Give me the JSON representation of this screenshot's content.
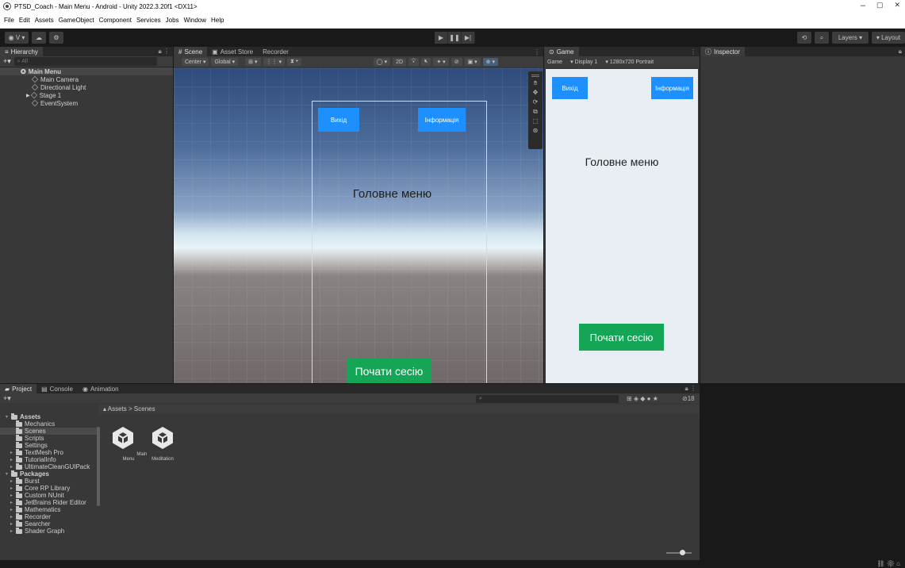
{
  "window": {
    "title": "PTSD_Coach - Main Menu - Android - Unity 2022.3.20f1 <DX11>",
    "controls": [
      "–",
      "▢",
      "✕"
    ]
  },
  "menu": [
    "File",
    "Edit",
    "Assets",
    "GameObject",
    "Component",
    "Services",
    "Jobs",
    "Window",
    "Help"
  ],
  "toolbar": {
    "account": "◉ V ▾",
    "right": {
      "layers": "Layers",
      "layout": "Layout"
    }
  },
  "hierarchy": {
    "tab": "Hierarchy",
    "search_placeholder": "All",
    "scene": "Main Menu",
    "items": [
      "Main Camera",
      "Directional Light",
      "Stage 1",
      "EventSystem"
    ]
  },
  "scene": {
    "tabs": [
      "Scene",
      "Asset Store",
      "Recorder"
    ],
    "toolbar": {
      "pivot": "Center ▾",
      "space": "Global ▾",
      "mode2d": "2D"
    },
    "ui": {
      "exit": "Вихід",
      "info": "Інформація",
      "heading": "Головне меню",
      "start": "Почати сесію"
    }
  },
  "game": {
    "tab": "Game",
    "toolbar": {
      "mode": "Game",
      "display": "Display 1",
      "resolution": "1280x720 Portrait"
    },
    "ui": {
      "exit": "Вихід",
      "info": "Інформація",
      "heading": "Головне меню",
      "start": "Почати сесію"
    }
  },
  "inspector": {
    "tab": "Inspector"
  },
  "project": {
    "tabs": [
      "Project",
      "Console",
      "Animation"
    ],
    "breadcrumb": "Assets  >  Scenes",
    "hidden_count": "18",
    "tree": [
      {
        "label": "Assets",
        "level": 0,
        "bold": true
      },
      {
        "label": "Mechanics",
        "level": 1
      },
      {
        "label": "Scenes",
        "level": 1,
        "selected": true
      },
      {
        "label": "Scripts",
        "level": 1
      },
      {
        "label": "Settings",
        "level": 1
      },
      {
        "label": "TextMesh Pro",
        "level": 1
      },
      {
        "label": "TutorialInfo",
        "level": 1
      },
      {
        "label": "UltimateCleanGUIPack",
        "level": 1
      },
      {
        "label": "Packages",
        "level": 0,
        "bold": true
      },
      {
        "label": "Burst",
        "level": 1
      },
      {
        "label": "Core RP Library",
        "level": 1
      },
      {
        "label": "Custom NUnit",
        "level": 1
      },
      {
        "label": "JetBrains Rider Editor",
        "level": 1
      },
      {
        "label": "Mathematics",
        "level": 1
      },
      {
        "label": "Recorder",
        "level": 1
      },
      {
        "label": "Searcher",
        "level": 1
      },
      {
        "label": "Shader Graph",
        "level": 1
      }
    ],
    "assets": [
      "Main Menu",
      "Meditation"
    ]
  }
}
